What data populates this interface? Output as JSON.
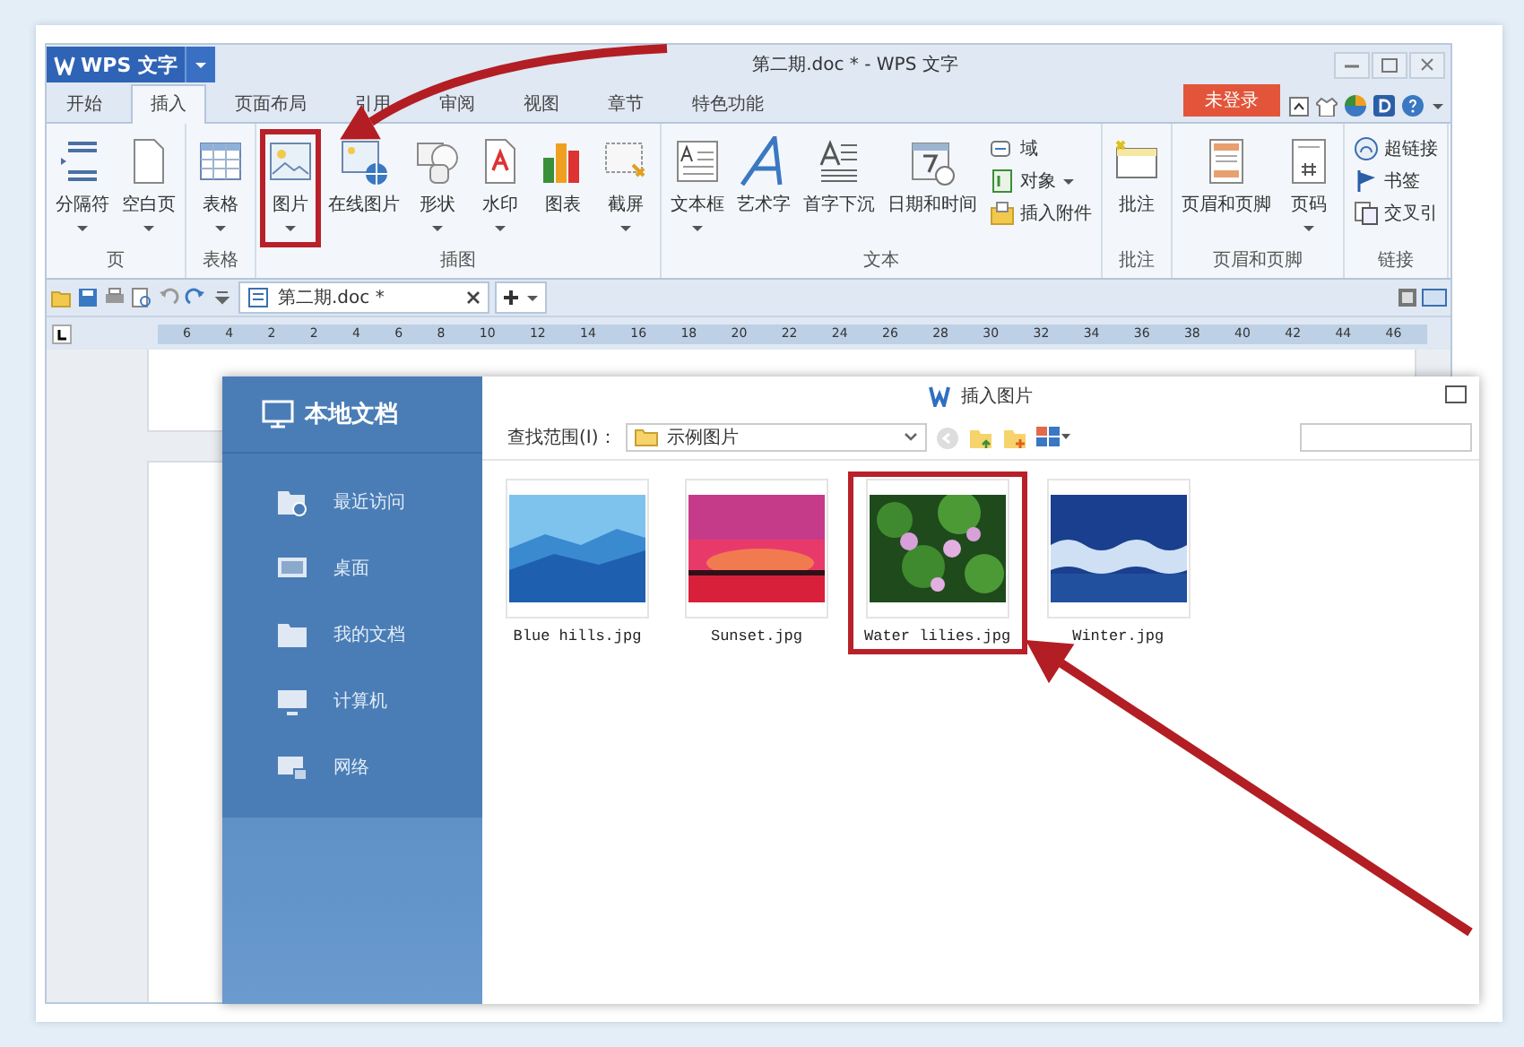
{
  "app_button": {
    "label": "WPS 文字"
  },
  "window": {
    "title": "第二期.doc * - WPS 文字"
  },
  "menu_tabs": [
    {
      "label": "开始",
      "selected": false
    },
    {
      "label": "插入",
      "selected": true
    },
    {
      "label": "页面布局",
      "selected": false
    },
    {
      "label": "引用",
      "selected": false
    },
    {
      "label": "审阅",
      "selected": false
    },
    {
      "label": "视图",
      "selected": false
    },
    {
      "label": "章节",
      "selected": false
    },
    {
      "label": "特色功能",
      "selected": false
    }
  ],
  "login_button": "未登录",
  "ribbon_groups": [
    {
      "label": "页",
      "items": [
        {
          "kind": "large",
          "label": "分隔符",
          "dropdown": true
        },
        {
          "kind": "large",
          "label": "空白页",
          "dropdown": true
        }
      ]
    },
    {
      "label": "表格",
      "items": [
        {
          "kind": "large",
          "label": "表格",
          "dropdown": true
        }
      ]
    },
    {
      "label": "插图",
      "items": [
        {
          "kind": "large",
          "label": "图片",
          "dropdown": true,
          "highlighted": true
        },
        {
          "kind": "large",
          "label": "在线图片",
          "dropdown": false
        },
        {
          "kind": "large",
          "label": "形状",
          "dropdown": true
        },
        {
          "kind": "large",
          "label": "水印",
          "dropdown": true
        },
        {
          "kind": "large",
          "label": "图表",
          "dropdown": false
        },
        {
          "kind": "large",
          "label": "截屏",
          "dropdown": true
        }
      ]
    },
    {
      "label": "文本",
      "items": [
        {
          "kind": "large",
          "label": "文本框",
          "dropdown": true
        },
        {
          "kind": "large",
          "label": "艺术字",
          "dropdown": false
        },
        {
          "kind": "large",
          "label": "首字下沉",
          "dropdown": false
        },
        {
          "kind": "large",
          "label": "日期和时间",
          "dropdown": false
        },
        {
          "kind": "small",
          "label": "域",
          "dropdown": false
        },
        {
          "kind": "small",
          "label": "对象",
          "dropdown": true
        },
        {
          "kind": "small",
          "label": "插入附件",
          "dropdown": false
        }
      ]
    },
    {
      "label": "批注",
      "items": [
        {
          "kind": "large",
          "label": "批注",
          "dropdown": false
        }
      ]
    },
    {
      "label": "页眉和页脚",
      "items": [
        {
          "kind": "large",
          "label": "页眉和页脚",
          "dropdown": false
        },
        {
          "kind": "large",
          "label": "页码",
          "dropdown": true
        }
      ]
    },
    {
      "label": "链接",
      "items": [
        {
          "kind": "small",
          "label": "超链接",
          "dropdown": false
        },
        {
          "kind": "small",
          "label": "书签",
          "dropdown": false
        },
        {
          "kind": "small",
          "label": "交叉引",
          "dropdown": false
        }
      ]
    }
  ],
  "document_tab": {
    "title": "第二期.doc *"
  },
  "ruler": {
    "labels": [
      "6",
      "4",
      "2",
      "2",
      "4",
      "6",
      "8",
      "10",
      "12",
      "14",
      "16",
      "18",
      "20",
      "22",
      "24",
      "26",
      "28",
      "30",
      "32",
      "34",
      "36",
      "38",
      "40",
      "42",
      "44",
      "46"
    ]
  },
  "dialog": {
    "title": "插入图片",
    "sidebar": {
      "title": "本地文档",
      "items": [
        {
          "label": "最近访问"
        },
        {
          "label": "桌面"
        },
        {
          "label": "我的文档"
        },
        {
          "label": "计算机"
        },
        {
          "label": "网络"
        }
      ]
    },
    "look_in_label": "查找范围(I)：",
    "look_in_value": "示例图片",
    "files": [
      {
        "name": "Blue hills.jpg",
        "highlighted": false
      },
      {
        "name": "Sunset.jpg",
        "highlighted": false
      },
      {
        "name": "Water lilies.jpg",
        "highlighted": true
      },
      {
        "name": "Winter.jpg",
        "highlighted": false
      }
    ]
  }
}
